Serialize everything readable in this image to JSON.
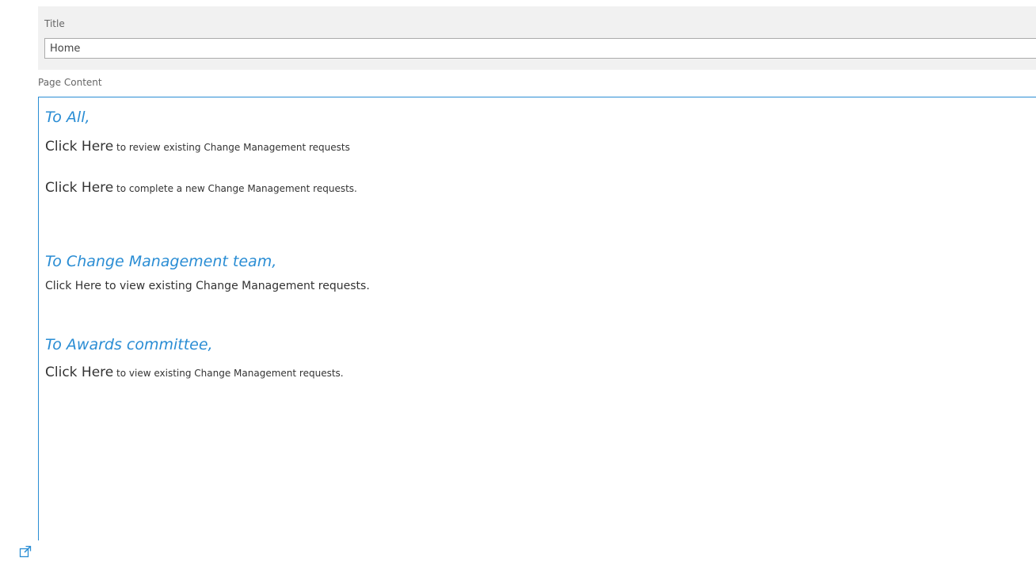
{
  "title_field": {
    "label": "Title",
    "value": "Home"
  },
  "content_field": {
    "label": "Page Content"
  },
  "content": {
    "section_all": {
      "heading": "To All,",
      "line1_link": "Click Here",
      "line1_rest": " to review existing Change Management requests",
      "line2_link": "Click Here",
      "line2_rest": " to complete a new Change Management requests."
    },
    "section_cm_team": {
      "heading": "To Change Management team,",
      "line1": "Click Here to view existing Change Management requests."
    },
    "section_awards": {
      "heading": "To Awards committee,",
      "line1_link": "Click Here",
      "line1_rest": " to view existing Change Management requests."
    }
  },
  "icons": {
    "popout": "open-in-new-window-icon"
  },
  "colors": {
    "accent": "#2a8dd4",
    "panel_bg": "#f1f1f1"
  }
}
